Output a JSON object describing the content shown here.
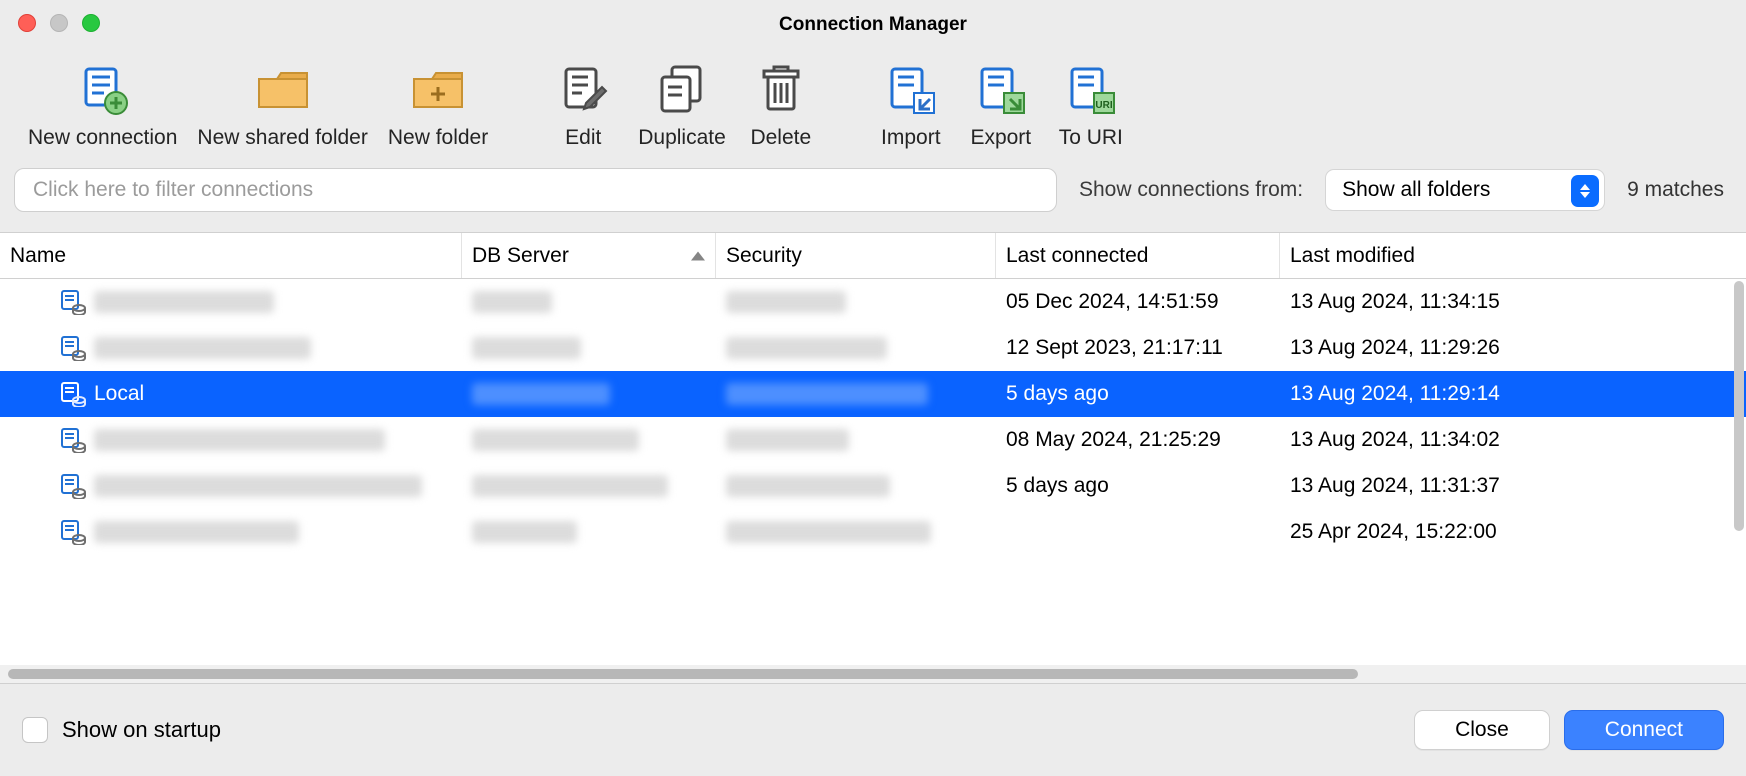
{
  "window": {
    "title": "Connection Manager"
  },
  "toolbar": {
    "new_connection": "New connection",
    "new_shared_folder": "New shared folder",
    "new_folder": "New folder",
    "edit": "Edit",
    "duplicate": "Duplicate",
    "delete": "Delete",
    "import": "Import",
    "export": "Export",
    "to_uri": "To URI"
  },
  "filter": {
    "placeholder": "Click here to filter connections",
    "show_from_label": "Show connections from:",
    "selected_folder": "Show all folders",
    "matches": "9 matches"
  },
  "columns": {
    "name": "Name",
    "db": "DB Server",
    "security": "Security",
    "last_connected": "Last connected",
    "last_modified": "Last modified",
    "sorted_column": "db",
    "sort_dir": "asc"
  },
  "rows": [
    {
      "name": "",
      "db": "",
      "security": "",
      "lc": "05 Dec 2024, 14:51:59",
      "lm": "13 Aug 2024, 11:34:15",
      "selected": false,
      "redacted": true
    },
    {
      "name": "",
      "db": "",
      "security": "",
      "lc": "12 Sept 2023, 21:17:11",
      "lm": "13 Aug 2024, 11:29:26",
      "selected": false,
      "redacted": true
    },
    {
      "name": "Local",
      "db": "",
      "security": "",
      "lc": "5 days ago",
      "lm": "13 Aug 2024, 11:29:14",
      "selected": true,
      "redacted": false
    },
    {
      "name": "",
      "db": "",
      "security": "",
      "lc": "08 May 2024, 21:25:29",
      "lm": "13 Aug 2024, 11:34:02",
      "selected": false,
      "redacted": true
    },
    {
      "name": "",
      "db": "",
      "security": "",
      "lc": "5 days ago",
      "lm": "13 Aug 2024, 11:31:37",
      "selected": false,
      "redacted": true
    },
    {
      "name": "",
      "db": "",
      "security": "",
      "lc": "",
      "lm": "25 Apr 2024, 15:22:00",
      "selected": false,
      "redacted": true
    }
  ],
  "footer": {
    "show_on_startup": "Show on startup",
    "close": "Close",
    "connect": "Connect"
  },
  "colors": {
    "accent": "#0a63ff",
    "accent_btn": "#3b82ff"
  }
}
